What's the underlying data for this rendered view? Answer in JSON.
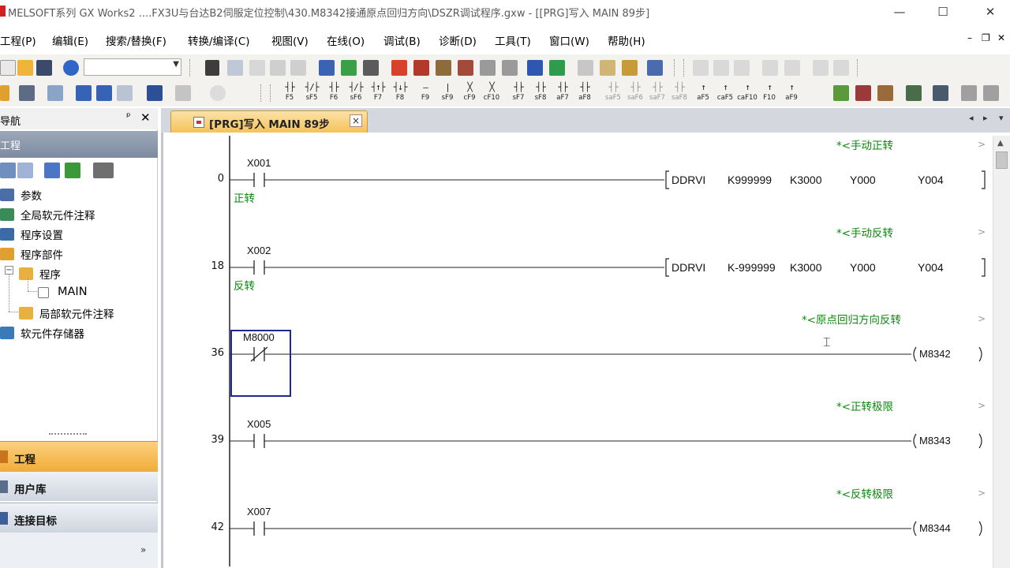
{
  "title": "MELSOFT系列 GX Works2 ....FX3U与台达B2伺服定位控制\\430.M8342接通原点回归方向\\DSZR调试程序.gxw - [[PRG]写入 MAIN 89步]",
  "window_controls": {
    "minimize": "—",
    "maximize": "☐",
    "close": "✕"
  },
  "menu": [
    "工程(P)",
    "编辑(E)",
    "搜索/替换(F)",
    "转换/编译(C)",
    "视图(V)",
    "在线(O)",
    "调试(B)",
    "诊断(D)",
    "工具(T)",
    "窗口(W)",
    "帮助(H)"
  ],
  "mdi_controls": {
    "minimize": "–",
    "restore": "❐",
    "close": "✕"
  },
  "toolbar2_fkeys": [
    {
      "sym": "┤├",
      "label": "F5"
    },
    {
      "sym": "┤/├",
      "label": "sF5"
    },
    {
      "sym": "┤├",
      "label": "F6"
    },
    {
      "sym": "┤/├",
      "label": "sF6"
    },
    {
      "sym": "┤↑├",
      "label": "F7"
    },
    {
      "sym": "┤↓├",
      "label": "F8"
    },
    {
      "sym": "—",
      "label": "F9"
    },
    {
      "sym": "|",
      "label": "sF9"
    },
    {
      "sym": "╳",
      "label": "cF9"
    },
    {
      "sym": "╳",
      "label": "cF10"
    },
    {
      "sym": "┤├",
      "label": "sF7"
    },
    {
      "sym": "┤├",
      "label": "sF8"
    },
    {
      "sym": "┤├",
      "label": "aF7"
    },
    {
      "sym": "┤├",
      "label": "aF8"
    },
    {
      "sym": "┤├",
      "label": "saF5"
    },
    {
      "sym": "┤├",
      "label": "saF6"
    },
    {
      "sym": "┤├",
      "label": "saF7"
    },
    {
      "sym": "┤├",
      "label": "saF8"
    },
    {
      "sym": "↑",
      "label": "aF5"
    },
    {
      "sym": "↑",
      "label": "caF5"
    },
    {
      "sym": "↑",
      "label": "caF10"
    },
    {
      "sym": "↑",
      "label": "F10"
    },
    {
      "sym": "↑",
      "label": "aF9"
    }
  ],
  "nav": {
    "title": "导航",
    "pin": "ᵖ",
    "close": "✕",
    "band": "工程",
    "tree": [
      {
        "label": "参数",
        "indent": 0
      },
      {
        "label": "全局软元件注释",
        "indent": 0
      },
      {
        "label": "程序设置",
        "indent": 0
      },
      {
        "label": "程序部件",
        "indent": 0
      },
      {
        "label": "程序",
        "indent": 1
      },
      {
        "label": "MAIN",
        "indent": 2
      },
      {
        "label": "局部软元件注释",
        "indent": 1
      },
      {
        "label": "软元件存储器",
        "indent": 0
      }
    ],
    "buttons": [
      "工程",
      "用户库",
      "连接目标"
    ],
    "more": "»"
  },
  "tab": {
    "label": "[PRG]写入 MAIN 89步",
    "close": "×"
  },
  "tab_nav": {
    "left": "◂",
    "right": "▸",
    "down": "▾"
  },
  "ladder": [
    {
      "step": "0",
      "device": "X001",
      "comment": "正转",
      "contact": "NO",
      "statement": "*<手动正转",
      "instruction": {
        "name": "DDRVI",
        "operands": [
          "K999999",
          "K3000",
          "Y000",
          "Y004"
        ]
      }
    },
    {
      "step": "18",
      "device": "X002",
      "comment": "反转",
      "contact": "NO",
      "statement": "*<手动反转",
      "instruction": {
        "name": "DDRVI",
        "operands": [
          "K-999999",
          "K3000",
          "Y000",
          "Y004"
        ]
      }
    },
    {
      "step": "36",
      "device": "M8000",
      "comment": "",
      "contact": "NC",
      "statement": "*<原点回归方向反转",
      "coil": "M8342"
    },
    {
      "step": "39",
      "device": "X005",
      "comment": "",
      "contact": "NO",
      "statement": "*<正转极限",
      "coil": "M8343"
    },
    {
      "step": "42",
      "device": "X007",
      "comment": "",
      "contact": "NO",
      "statement": "*<反转极限",
      "coil": "M8344"
    }
  ],
  "colors": {
    "comment_green": "#0a8a0a",
    "cursor_blue": "#1e2a8f",
    "nav_band": "#8a96ab",
    "nav_button": "#f5b94a",
    "tab": "#f7c865"
  },
  "icons": [
    "close-icon",
    "minimize-icon",
    "maximize-icon",
    "folder-icon",
    "program-icon",
    "parameter-icon"
  ]
}
